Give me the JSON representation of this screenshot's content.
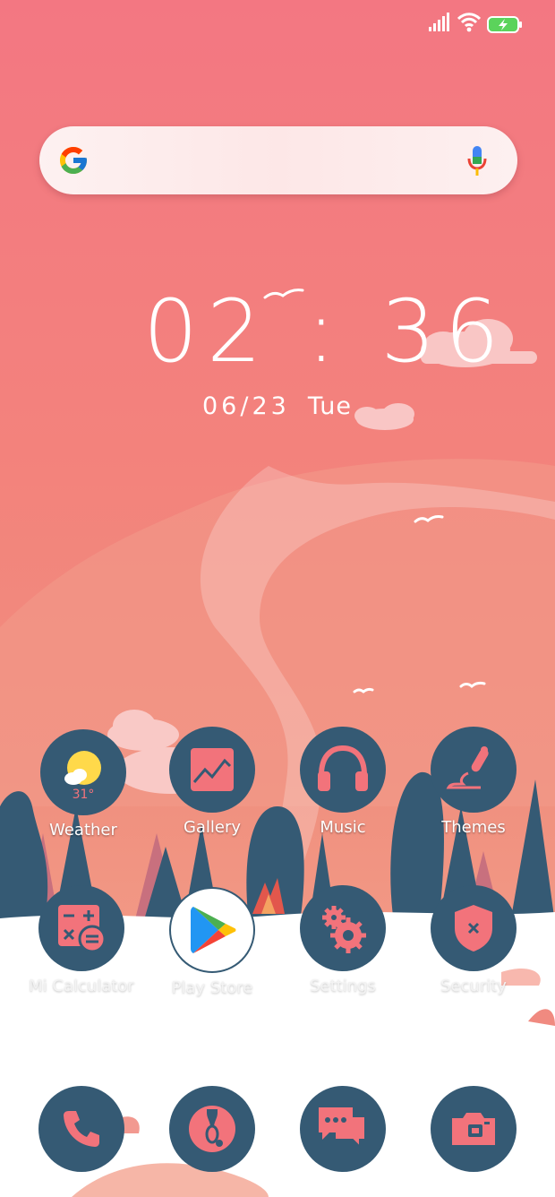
{
  "clock": {
    "time": "02 : 36",
    "date": "06/23",
    "day": "Tue"
  },
  "apps_row1": [
    {
      "label": "Weather",
      "icon": "weather-icon",
      "temp": "31°"
    },
    {
      "label": "Gallery",
      "icon": "gallery-icon"
    },
    {
      "label": "Music",
      "icon": "headphones-icon"
    },
    {
      "label": "Themes",
      "icon": "brush-icon"
    }
  ],
  "apps_row2": [
    {
      "label": "Mi Calculator",
      "icon": "calculator-icon"
    },
    {
      "label": "Play Store",
      "icon": "play-store-icon"
    },
    {
      "label": "Settings",
      "icon": "gear-icon"
    },
    {
      "label": "Security",
      "icon": "shield-icon"
    }
  ],
  "dock": [
    {
      "icon": "phone-icon"
    },
    {
      "icon": "browser-icon"
    },
    {
      "icon": "messages-icon"
    },
    {
      "icon": "camera-icon"
    }
  ],
  "colors": {
    "icon_bg": "#355a74",
    "accent": "#f2737b",
    "background_top": "#f37782"
  }
}
